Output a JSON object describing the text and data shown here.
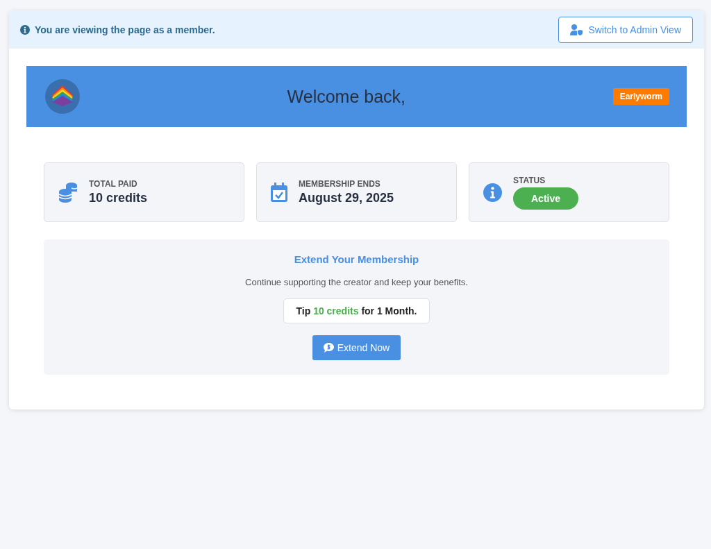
{
  "notice": {
    "text": "You are viewing the page as a member.",
    "button": "Switch to Admin View"
  },
  "banner": {
    "title": "Welcome back,",
    "badge": "Earlyworm"
  },
  "stats": [
    {
      "kind": "coins",
      "label": "TOTAL PAID",
      "value": "10 credits"
    },
    {
      "kind": "calendar",
      "label": "MEMBERSHIP ENDS",
      "value": "August 29, 2025"
    },
    {
      "kind": "status",
      "label": "STATUS",
      "value": "Active"
    }
  ],
  "extend": {
    "title": "Extend Your Membership",
    "subtitle": "Continue supporting the creator and keep your benefits.",
    "tip": {
      "prefix": "Tip",
      "amount": "10 credits",
      "suffix": "for 1 Month."
    },
    "button": "Extend Now"
  }
}
